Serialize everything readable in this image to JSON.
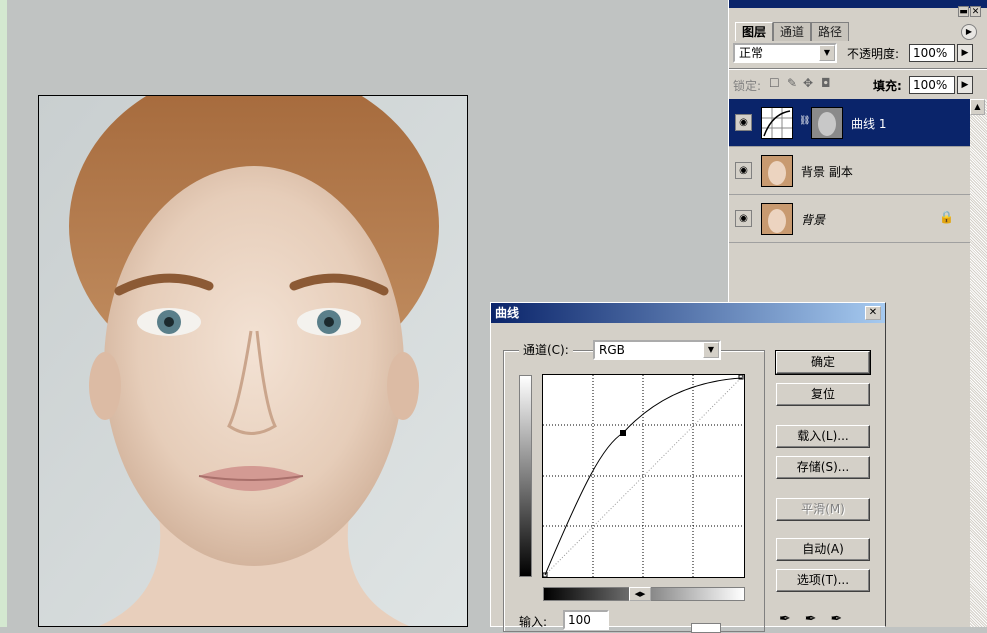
{
  "layers_panel": {
    "tabs": [
      "图层",
      "通道",
      "路径"
    ],
    "blend_mode": "正常",
    "opacity_label": "不透明度:",
    "opacity_value": "100%",
    "lock_label": "锁定:",
    "fill_label": "填充:",
    "fill_value": "100%",
    "layers": [
      {
        "name": "曲线 1",
        "selected": true,
        "type": "adjustment"
      },
      {
        "name": "背景 副本",
        "selected": false,
        "type": "image"
      },
      {
        "name": "背景",
        "selected": false,
        "type": "image",
        "locked": true
      }
    ]
  },
  "curves_dialog": {
    "title": "曲线",
    "channel_label": "通道(C):",
    "channel_value": "RGB",
    "input_label": "输入:",
    "input_value": "100",
    "buttons": {
      "ok": "确定",
      "reset": "复位",
      "load": "载入(L)...",
      "save": "存储(S)...",
      "smooth": "平滑(M)",
      "auto": "自动(A)",
      "options": "选项(T)..."
    }
  },
  "icons": {
    "visibility": "eye-icon",
    "lock": "lock-icon",
    "close": "close-icon",
    "minimize": "minimize-icon",
    "eyedropper": "eyedropper-icon"
  },
  "colors": {
    "title_blue": "#0a246a",
    "panel_gray": "#d4d0c8",
    "canvas_bg": "#c0c3c2"
  }
}
